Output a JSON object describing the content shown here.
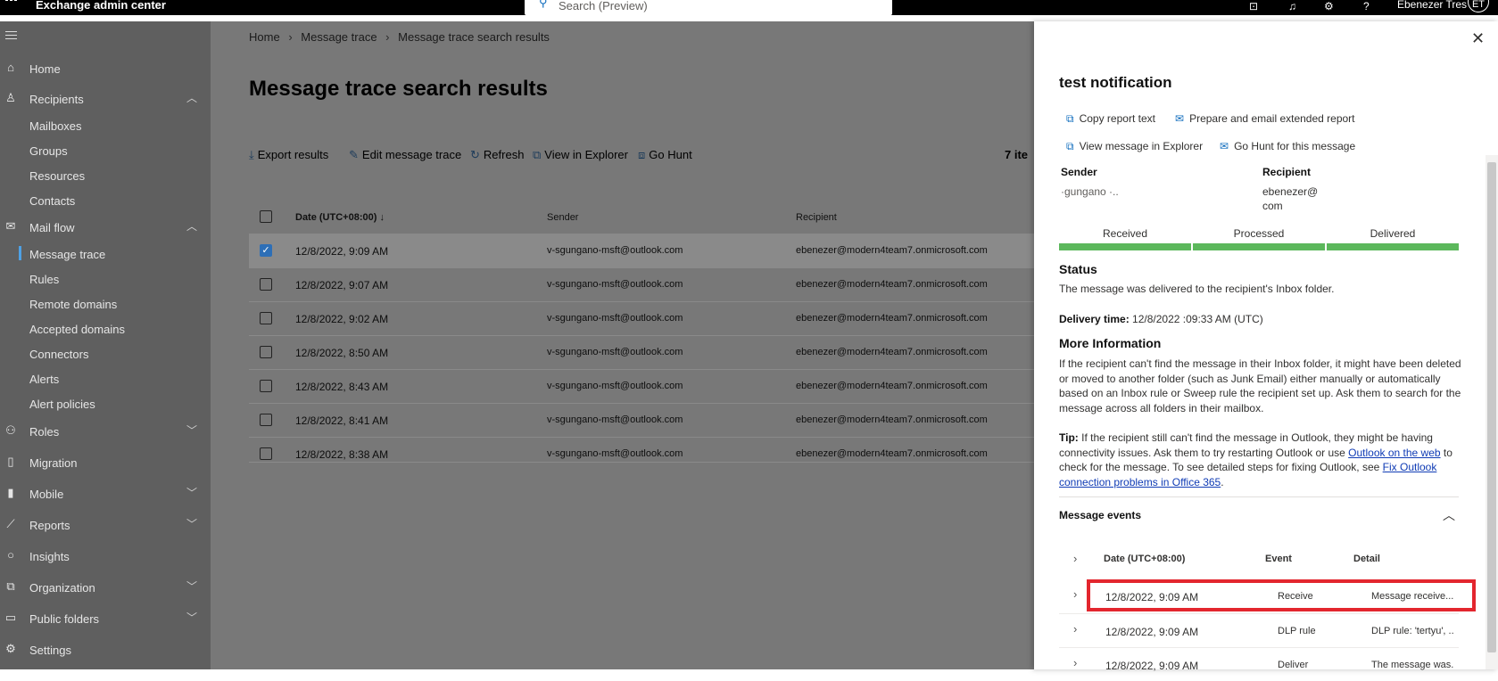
{
  "topbar": {
    "app_title": "Exchange admin center",
    "search_placeholder": "Search (Preview)",
    "user_name": "Ebenezer Tres",
    "avatar_initials": "ET",
    "help_glyph": "?"
  },
  "sidebar": {
    "items": [
      {
        "label": "Home",
        "icon": "home-icon"
      },
      {
        "label": "Recipients",
        "icon": "person-icon"
      },
      {
        "label": "Mailboxes"
      },
      {
        "label": "Groups"
      },
      {
        "label": "Resources"
      },
      {
        "label": "Contacts"
      },
      {
        "label": "Mail flow",
        "icon": "mail-icon"
      },
      {
        "label": "Message trace",
        "active": true
      },
      {
        "label": "Rules"
      },
      {
        "label": "Remote domains"
      },
      {
        "label": "Accepted domains"
      },
      {
        "label": "Connectors"
      },
      {
        "label": "Alerts"
      },
      {
        "label": "Alert policies"
      },
      {
        "label": "Roles",
        "icon": "roles-icon"
      },
      {
        "label": "Migration",
        "icon": "migration-icon"
      },
      {
        "label": "Mobile",
        "icon": "mobile-icon"
      },
      {
        "label": "Reports",
        "icon": "chart-icon"
      },
      {
        "label": "Insights",
        "icon": "bulb-icon"
      },
      {
        "label": "Organization",
        "icon": "org-icon"
      },
      {
        "label": "Public folders",
        "icon": "folder-icon"
      },
      {
        "label": "Settings",
        "icon": "gear-icon"
      }
    ]
  },
  "breadcrumb": [
    "Home",
    "Message trace",
    "Message trace search results"
  ],
  "page_title": "Message trace search results",
  "toolbar": {
    "export": "Export results",
    "edit": "Edit message trace",
    "refresh": "Refresh",
    "explorer": "View in Explorer",
    "hunt": "Go Hunt",
    "count": "7 ite"
  },
  "grid": {
    "columns": [
      "Date (UTC+08:00)",
      "Sender",
      "Recipient"
    ],
    "sort_glyph": "↓",
    "rows": [
      {
        "date": "12/8/2022, 9:09 AM",
        "sender": "v-sgungano-msft@outlook.com",
        "recipient": "ebenezer@modern4team7.onmicrosoft.com",
        "selected": true
      },
      {
        "date": "12/8/2022, 9:07 AM",
        "sender": "v-sgungano-msft@outlook.com",
        "recipient": "ebenezer@modern4team7.onmicrosoft.com"
      },
      {
        "date": "12/8/2022, 9:02 AM",
        "sender": "v-sgungano-msft@outlook.com",
        "recipient": "ebenezer@modern4team7.onmicrosoft.com"
      },
      {
        "date": "12/8/2022, 8:50 AM",
        "sender": "v-sgungano-msft@outlook.com",
        "recipient": "ebenezer@modern4team7.onmicrosoft.com"
      },
      {
        "date": "12/8/2022, 8:43 AM",
        "sender": "v-sgungano-msft@outlook.com",
        "recipient": "ebenezer@modern4team7.onmicrosoft.com"
      },
      {
        "date": "12/8/2022, 8:41 AM",
        "sender": "v-sgungano-msft@outlook.com",
        "recipient": "ebenezer@modern4team7.onmicrosoft.com"
      },
      {
        "date": "12/8/2022, 8:38 AM",
        "sender": "v-sgungano-msft@outlook.com",
        "recipient": "ebenezer@modern4team7.onmicrosoft.com"
      }
    ]
  },
  "panel": {
    "title": "test notification",
    "actions": {
      "copy": "Copy report text",
      "email": "Prepare and email extended report",
      "explorer": "View message in Explorer",
      "hunt": "Go Hunt for this message"
    },
    "sender_label": "Sender",
    "sender_value": "·gungano  ·..",
    "recipient_label": "Recipient",
    "recipient_line1": "ebenezer@",
    "recipient_line2": "com",
    "progress": [
      {
        "label": "Received",
        "complete": 1
      },
      {
        "label": "Processed",
        "complete": 1
      },
      {
        "label": "Delivered",
        "complete": 1
      }
    ],
    "status_heading": "Status",
    "status_text": "The message was delivered to the recipient's Inbox folder.",
    "delivery_label": "Delivery time:",
    "delivery_value": "12/8/2022  :09:33 AM (UTC)",
    "more_heading": "More Information",
    "more_text": "If the recipient can't find the message in their Inbox folder, it might have been deleted or moved to another folder (such as Junk Email) either manually or automatically based on an Inbox rule or Sweep rule the recipient set up. Ask them to search for the message across all folders in their mailbox.",
    "tip_label": "Tip:",
    "tip_text1": "If the recipient still can't find the message in Outlook, they might be having connectivity issues. Ask them to try restarting Outlook or use",
    "tip_link1": "Outlook on the web",
    "tip_text2": "to check for the message. To see detailed steps for fixing Outlook, see",
    "tip_link2": "Fix Outlook connection problems in Office 365",
    "tip_end": ".",
    "events_heading": "Message events",
    "event_columns": [
      "Date (UTC+08:00)",
      "Event",
      "Detail"
    ],
    "events": [
      {
        "date": "12/8/2022, 9:09 AM",
        "event": "Receive",
        "detail": "Message receive..."
      },
      {
        "date": "12/8/2022, 9:09 AM",
        "event": "DLP rule",
        "detail": "DLP rule: 'tertyu', ..."
      },
      {
        "date": "12/8/2022, 9:09 AM",
        "event": "Deliver",
        "detail": "The message was..."
      }
    ]
  },
  "colors": {
    "progress_green": "#5cb85c",
    "highlight_red": "#e3262e",
    "link": "#0f3bb5"
  }
}
